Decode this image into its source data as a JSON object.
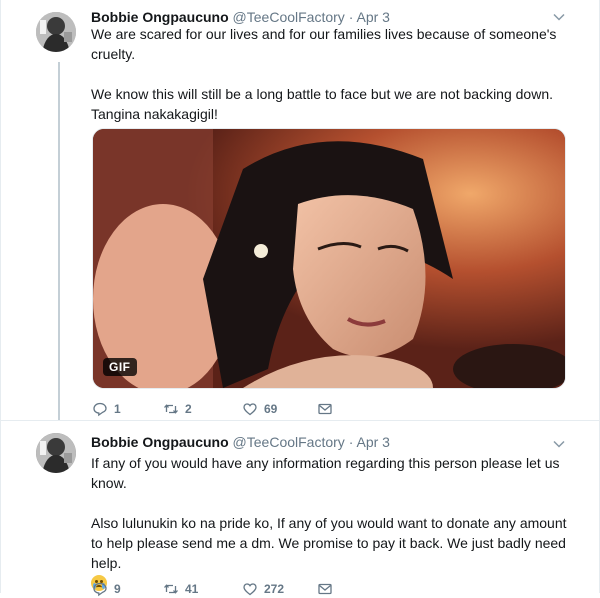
{
  "tweets": [
    {
      "name": "Bobbie Ongpaucuno",
      "handle": "@TeeCoolFactory",
      "separator": "·",
      "date": "Apr 3",
      "para1": "We are scared for our lives and for our families lives because of someone's cruelty.",
      "para2": "We know this will still be a long battle to face but we are not backing down. Tangina nakakagigil!",
      "media_badge": "GIF",
      "replies": "1",
      "retweets": "2",
      "likes": "69"
    },
    {
      "name": "Bobbie Ongpaucuno",
      "handle": "@TeeCoolFactory",
      "separator": "·",
      "date": "Apr 3",
      "para1": "If any of you would have any information regarding this person please let us know.",
      "para2": "Also lulunukin ko na pride ko, If any of you would want to donate any amount to help please send me a dm. We promise to pay it back. We just badly need help.",
      "emoji": "crying-face",
      "replies": "9",
      "retweets": "41",
      "likes": "272"
    }
  ],
  "colors": {
    "text": "#14171a",
    "secondary": "#657786",
    "thread_line": "#c4cfd6",
    "divider": "#e6ecf0"
  }
}
